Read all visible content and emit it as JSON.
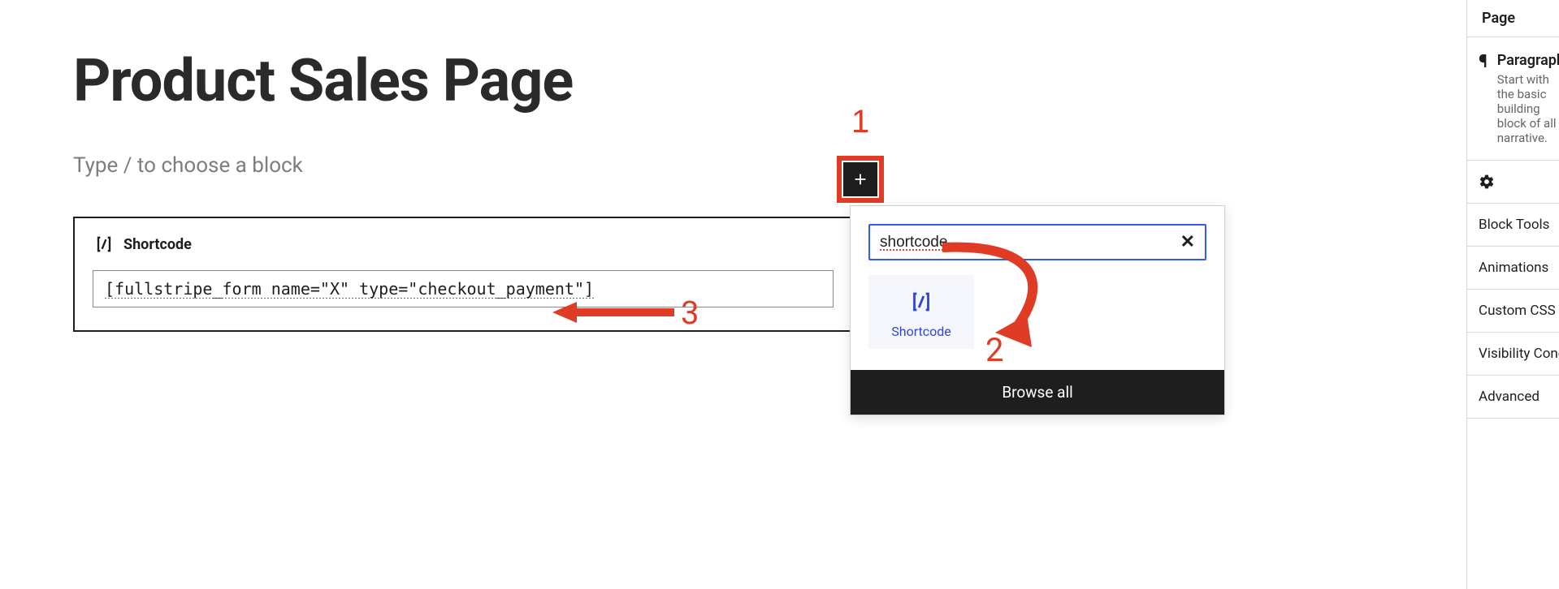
{
  "editor": {
    "title": "Product Sales Page",
    "placeholder": "Type / to choose a block",
    "shortcode_block": {
      "label": "Shortcode",
      "value": "[fullstripe_form name=\"X\" type=\"checkout_payment\"]"
    }
  },
  "inserter": {
    "search_value": "shortcode",
    "result_label": "Shortcode",
    "footer_label": "Browse all"
  },
  "annotations": {
    "n1": "1",
    "n2": "2",
    "n3": "3"
  },
  "sidebar": {
    "tabs": {
      "page": "Page"
    },
    "block": {
      "name": "Paragraph",
      "desc": "Start with the basic building block of all narrative."
    },
    "sections": {
      "block_tools": "Block Tools",
      "animations": "Animations",
      "custom_css": "Custom CSS",
      "visibility": "Visibility Conditions",
      "advanced": "Advanced"
    }
  }
}
